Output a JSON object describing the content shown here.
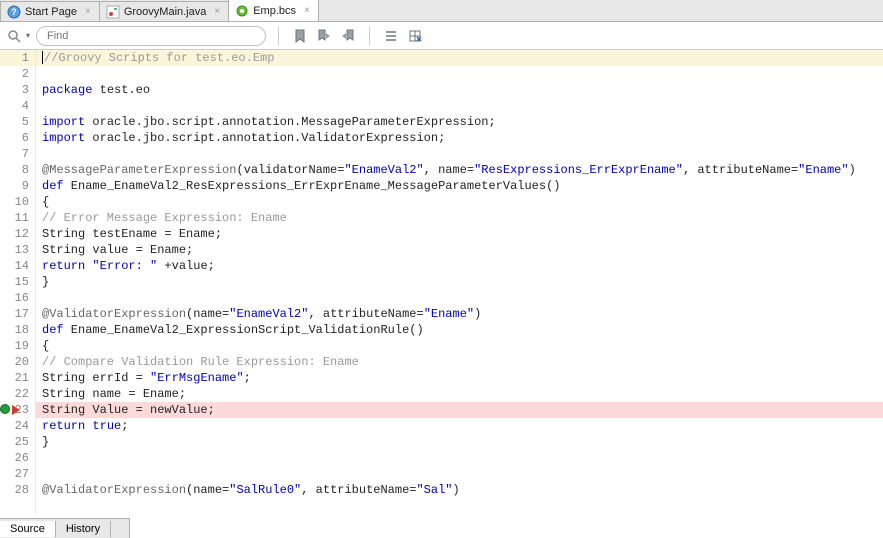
{
  "tabs": [
    {
      "label": "Start Page",
      "icon": "help"
    },
    {
      "label": "GroovyMain.java",
      "icon": "java"
    },
    {
      "label": "Emp.bcs",
      "icon": "green"
    }
  ],
  "find": {
    "placeholder": "Find"
  },
  "bottom": {
    "source": "Source",
    "history": "History"
  },
  "code": {
    "l1": "//Groovy Scripts for test.eo.Emp",
    "l3a": "package",
    "l3b": " test.eo",
    "l5a": "import",
    "l5b": " oracle.jbo.script.annotation.MessageParameterExpression;",
    "l6a": "import",
    "l6b": " oracle.jbo.script.annotation.ValidatorExpression;",
    "l8a": "@MessageParameterExpression",
    "l8b": "(validatorName=",
    "l8c": "\"EnameVal2\"",
    "l8d": ", name=",
    "l8e": "\"ResExpressions_ErrExprEname\"",
    "l8f": ", attributeName=",
    "l8g": "\"Ename\"",
    "l8h": ")",
    "l9a": "def",
    "l9b": " Ename_EnameVal2_ResExpressions_ErrExprEname_MessageParameterValues()",
    "l10": "{",
    "l11": "// Error Message Expression: Ename",
    "l12": "String testEname = Ename;",
    "l13": "String value = Ename;",
    "l14a": "return",
    "l14b": " ",
    "l14c": "\"Error: \"",
    "l14d": " +value;",
    "l15": "}",
    "l17a": "@ValidatorExpression",
    "l17b": "(name=",
    "l17c": "\"EnameVal2\"",
    "l17d": ", attributeName=",
    "l17e": "\"Ename\"",
    "l17f": ")",
    "l18a": "def",
    "l18b": " Ename_EnameVal2_ExpressionScript_ValidationRule()",
    "l19": "{",
    "l20": "// Compare Validation Rule Expression: Ename",
    "l21a": "String errId = ",
    "l21b": "\"ErrMsgEname\"",
    "l21c": ";",
    "l22": "String name = Ename;",
    "l23": "String Value = newValue;",
    "l24a": "return",
    "l24b": " ",
    "l24c": "true",
    "l24d": ";",
    "l25": "}",
    "l28a": "@ValidatorExpression",
    "l28b": "(name=",
    "l28c": "\"SalRule0\"",
    "l28d": ", attributeName=",
    "l28e": "\"Sal\"",
    "l28f": ")"
  },
  "lines": [
    "1",
    "2",
    "3",
    "4",
    "5",
    "6",
    "7",
    "8",
    "9",
    "10",
    "11",
    "12",
    "13",
    "14",
    "15",
    "16",
    "17",
    "18",
    "19",
    "20",
    "21",
    "22",
    "23",
    "24",
    "25",
    "26",
    "27",
    "28"
  ]
}
